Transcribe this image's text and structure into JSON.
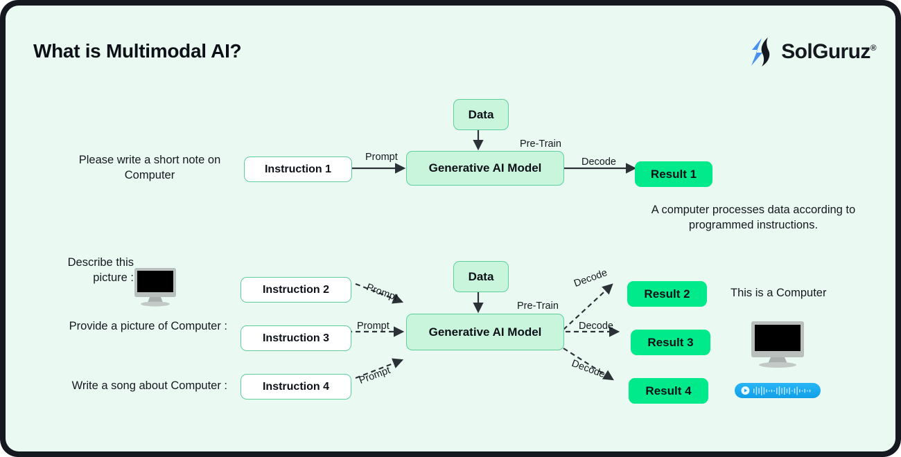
{
  "header": {
    "title": "What is Multimodal AI?",
    "logo_text": "SolGuruz",
    "logo_registered": "®"
  },
  "row1": {
    "prompt_text": "Please write a short note on Computer",
    "instruction_label": "Instruction 1",
    "prompt_edge_label": "Prompt",
    "data_label": "Data",
    "pretrain_edge_label": "Pre-Train",
    "model_label": "Generative AI Model",
    "decode_edge_label": "Decode",
    "result_label": "Result 1",
    "result_caption": "A computer processes data according to programmed instructions."
  },
  "row2": {
    "data_label": "Data",
    "pretrain_edge_label": "Pre-Train",
    "model_label": "Generative AI Model",
    "inputs": [
      {
        "text": "Describe this picture :",
        "instruction_label": "Instruction 2",
        "edge_label": "Prompt"
      },
      {
        "text": "Provide a picture of Computer :",
        "instruction_label": "Instruction 3",
        "edge_label": "Prompt"
      },
      {
        "text": "Write a song about Computer :",
        "instruction_label": "Instruction 4",
        "edge_label": "Prompt"
      }
    ],
    "outputs": [
      {
        "result_label": "Result 2",
        "edge_label": "Decode"
      },
      {
        "result_label": "Result 3",
        "edge_label": "Decode"
      },
      {
        "result_label": "Result 4",
        "edge_label": "Decode"
      }
    ],
    "answer_text": "This is a Computer"
  },
  "icons": {
    "input_monitor": "monitor-icon",
    "output_monitor": "monitor-icon",
    "audio_play": "play-icon",
    "audio_waveform": "waveform-icon",
    "logo_mark": "solguruz-logo-icon"
  },
  "colors": {
    "page_background": "#eafaf2",
    "frame": "#15181f",
    "node_mint_fill": "#c9f5dd",
    "node_border": "#5ccf9b",
    "result_green": "#00e98a",
    "logo_blue": "#4a90f0",
    "audio_blue": "#19a7f0",
    "text": "#15181f"
  }
}
